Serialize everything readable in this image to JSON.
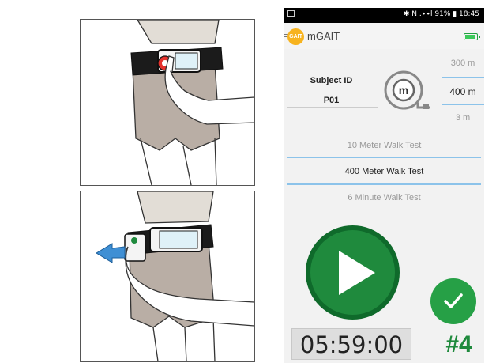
{
  "status_bar": {
    "indicators": "✱ N .∙∙l 91% ▮ 18:45"
  },
  "app": {
    "logo_text": "GAIT",
    "title": "mGAIT",
    "battery_level": 0.9
  },
  "subject": {
    "label": "Subject ID",
    "value": "P01"
  },
  "distance_picker": {
    "options": [
      "300 m",
      "400 m",
      "3 m"
    ],
    "selected": "400 m",
    "icon": "measuring-tape-icon"
  },
  "tests": {
    "options": [
      "10 Meter Walk Test",
      "400 Meter Walk Test",
      "6 Minute Walk Test"
    ],
    "selected": "400 Meter Walk Test"
  },
  "controls": {
    "play_icon": "play-icon",
    "check_icon": "checkmark-icon"
  },
  "timer": "05:59:00",
  "counter": "#4",
  "colors": {
    "green_dark": "#1f8a3d",
    "green": "#26a046",
    "accent_line": "#8cc3ea",
    "logo": "#f7b31e"
  }
}
